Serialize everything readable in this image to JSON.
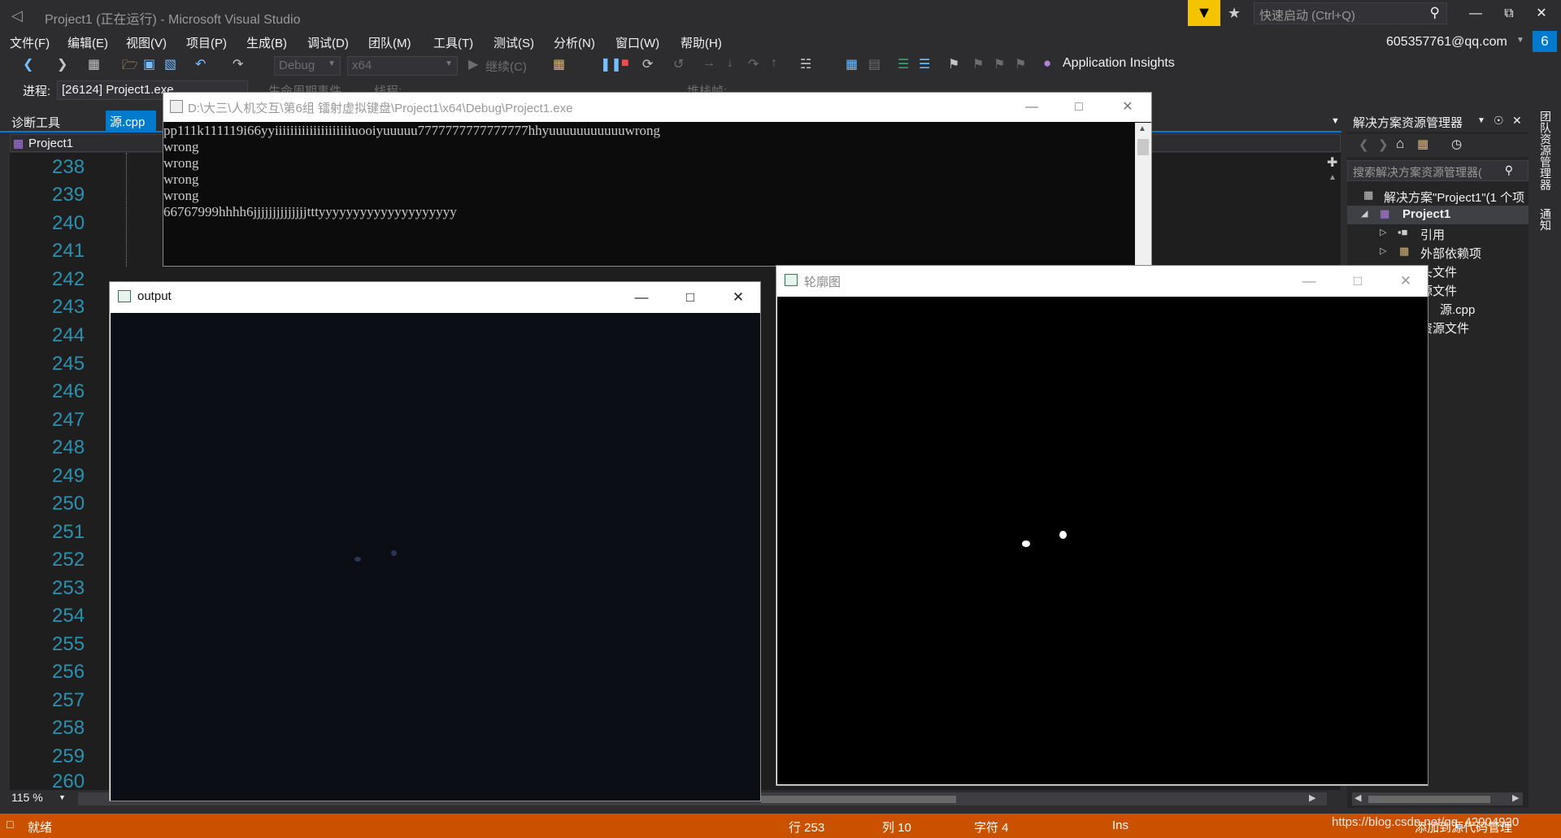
{
  "titlebar": {
    "title": "Project1 (正在运行) - Microsoft Visual Studio",
    "quick_launch_placeholder": "快速启动 (Ctrl+Q)"
  },
  "menu": [
    "文件(F)",
    "编辑(E)",
    "视图(V)",
    "项目(P)",
    "生成(B)",
    "调试(D)",
    "团队(M)",
    "工具(T)",
    "测试(S)",
    "分析(N)",
    "窗口(W)",
    "帮助(H)"
  ],
  "account": "605357761@qq.com",
  "notification_count": "6",
  "toolbar": {
    "config": "Debug",
    "platform": "x64",
    "continue_label": "继续(C)",
    "application_insights": "Application Insights",
    "lifecycle_label": "生命周期事件",
    "thread_label": "线程:",
    "stack_label": "堆栈帧:"
  },
  "process": {
    "label": "进程:",
    "value": "[26124] Project1.exe"
  },
  "tabs": {
    "diag": "诊断工具",
    "source": "源.cpp"
  },
  "nav_project": "Project1",
  "line_numbers": [
    "238",
    "239",
    "240",
    "241",
    "242",
    "243",
    "244",
    "245",
    "246",
    "247",
    "248",
    "249",
    "250",
    "251",
    "252",
    "253",
    "254",
    "255",
    "256",
    "257",
    "258",
    "259",
    "260"
  ],
  "zoom": "115 %",
  "solution_explorer": {
    "title": "解决方案资源管理器",
    "search_placeholder": "搜索解决方案资源管理器(",
    "solution": "解决方案\"Project1\"(1 个项",
    "project": "Project1",
    "items": [
      "引用",
      "外部依赖项",
      "头文件",
      "源文件",
      "源.cpp",
      "资源文件"
    ]
  },
  "side_tabs": [
    "团队资源管理器",
    "通知"
  ],
  "status": {
    "ready": "就绪",
    "line": "行 253",
    "col": "列 10",
    "char": "字符 4",
    "ins": "Ins",
    "add_source": "添加到源代码管理"
  },
  "watermark": "https://blog.csdn.net/qq_42004920",
  "console": {
    "title": "D:\\大三\\人机交互\\第6组 镭射虚拟键盘\\Project1\\x64\\Debug\\Project1.exe",
    "lines": [
      "pp111k111119i66yyiiiiiiiiiiiiiiiiiiiiuooiyuuuuu7777777777777777hhyuuuuuuuuuuuwrong",
      "wrong",
      "wrong",
      "wrong",
      "wrong",
      "66767999hhhh6jjjjjjjjjjjjjjtttyyyyyyyyyyyyyyyyyyyy"
    ]
  },
  "output_window": {
    "title": "output"
  },
  "contour_window": {
    "title": "轮廓图"
  }
}
